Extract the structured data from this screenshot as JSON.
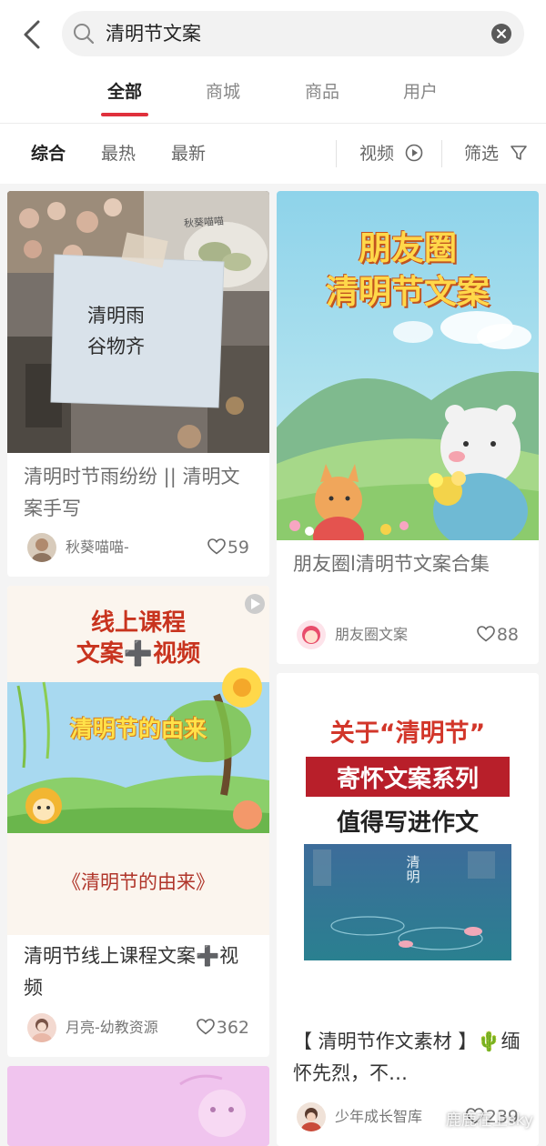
{
  "search": {
    "query": "清明节文案"
  },
  "tabs": [
    {
      "label": "全部",
      "active": true
    },
    {
      "label": "商城",
      "active": false
    },
    {
      "label": "商品",
      "active": false
    },
    {
      "label": "用户",
      "active": false
    }
  ],
  "sortbar": {
    "options": [
      "综合",
      "最热",
      "最新"
    ],
    "video_label": "视频",
    "filter_label": "筛选"
  },
  "feed": [
    {
      "image_text": [
        "清明雨",
        "谷物齐"
      ],
      "image_corner_text": "秋葵喵喵",
      "title": "清明时节雨纷纷 || 清明文案手写",
      "author": "秋葵喵喵-",
      "likes": "59"
    },
    {
      "image_text": [
        "朋友圈",
        "清明节文案"
      ],
      "title": "朋友圈l清明节文案合集",
      "author": "朋友圈文案",
      "likes": "88"
    },
    {
      "image_text": [
        "线上课程",
        "文案➕视频",
        "清明节的由来",
        "《清明节的由来》"
      ],
      "title": "清明节线上课程文案➕视频",
      "author": "月亮-幼教资源",
      "likes": "362"
    },
    {
      "image_text": [
        "关于“清明节”",
        "寄怀文案系列",
        "值得写进作文",
        "清明"
      ],
      "title": "【 清明节作文素材 】🌵缅怀先烈，不…",
      "author": "少年成长智库",
      "likes": "239"
    }
  ],
  "watermark": "鹿鹿在上sky",
  "colors": {
    "accent": "#e0303c",
    "text_primary": "#222222",
    "text_secondary": "#777777",
    "background": "#f4f4f4"
  }
}
